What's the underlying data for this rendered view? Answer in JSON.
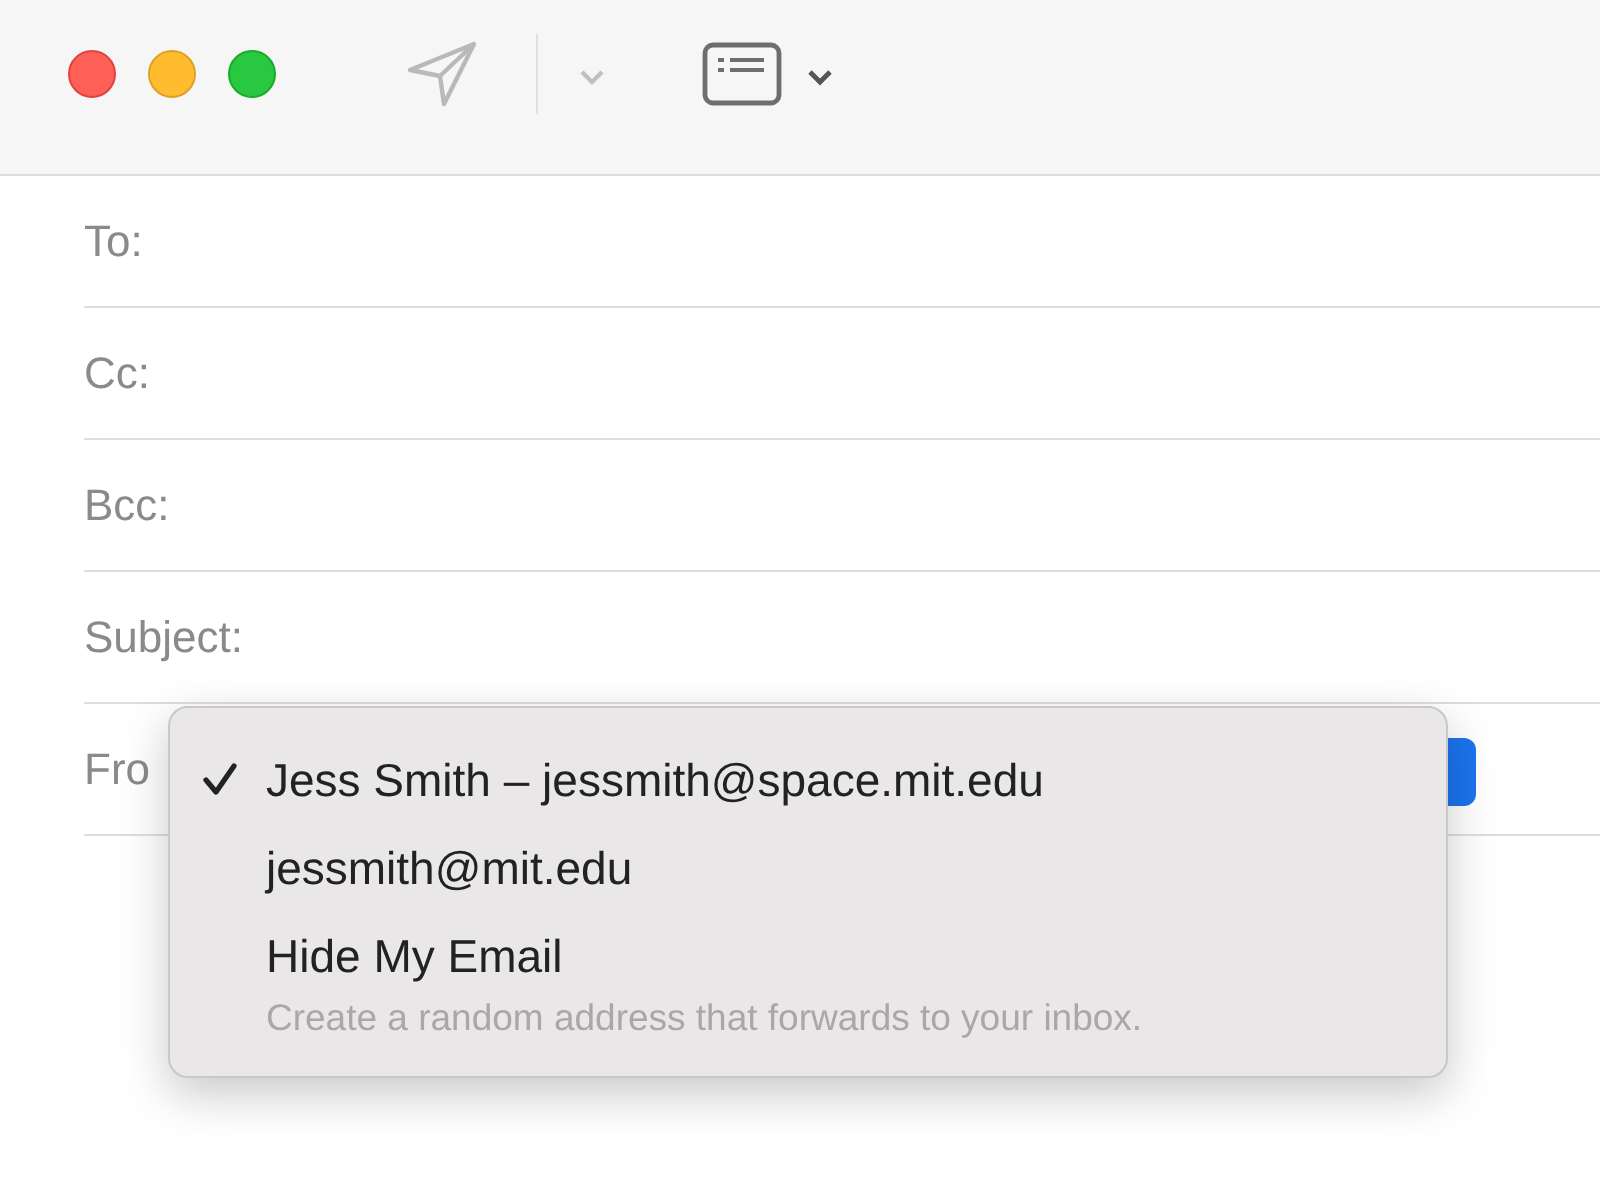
{
  "fields": [
    {
      "label": "To:"
    },
    {
      "label": "Cc:"
    },
    {
      "label": "Bcc:"
    },
    {
      "label": "Subject:"
    },
    {
      "label": "Fro",
      "kind": "popup"
    }
  ],
  "menu": {
    "items": [
      {
        "label": "Jess Smith – jessmith@space.mit.edu",
        "selected": true
      },
      {
        "label": "jessmith@mit.edu",
        "selected": false
      },
      {
        "label": "Hide My Email",
        "description": "Create a random address that forwards to your inbox.",
        "selected": false
      }
    ]
  }
}
